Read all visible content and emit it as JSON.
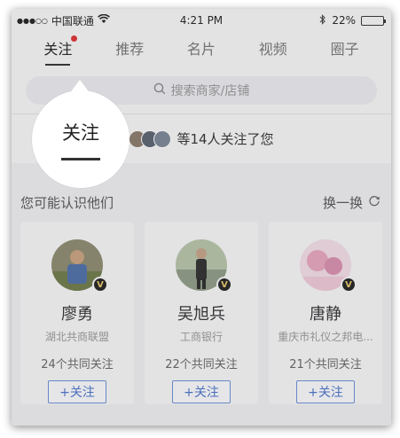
{
  "status_bar": {
    "carrier": "中国联通",
    "time": "4:21 PM",
    "battery": "22%",
    "battery_level": 0.22
  },
  "tabs": [
    {
      "label": "关注",
      "active": true,
      "has_dot": true
    },
    {
      "label": "推荐",
      "active": false
    },
    {
      "label": "名片",
      "active": false
    },
    {
      "label": "视频",
      "active": false
    },
    {
      "label": "圈子",
      "active": false
    }
  ],
  "search": {
    "placeholder": "搜索商家/店铺",
    "icon": "search-icon"
  },
  "followers": {
    "text": "等14人关注了您"
  },
  "spotlight": {
    "label": "关注"
  },
  "suggestions": {
    "title": "您可能认识他们",
    "refresh_label": "换一换",
    "cards": [
      {
        "name": "廖勇",
        "org": "湖北共商联盟",
        "mutual": "24个共同关注",
        "follow_label": "+关注",
        "badge": "V"
      },
      {
        "name": "吴旭兵",
        "org": "工商银行",
        "mutual": "22个共同关注",
        "follow_label": "+关注",
        "badge": "V"
      },
      {
        "name": "唐静",
        "org": "重庆市礼仪之邦电...",
        "mutual": "21个共同关注",
        "follow_label": "+关注",
        "badge": "V"
      }
    ]
  },
  "colors": {
    "accent": "#4a74c8",
    "dot": "#e03131",
    "badge_gold": "#e8c66a"
  }
}
